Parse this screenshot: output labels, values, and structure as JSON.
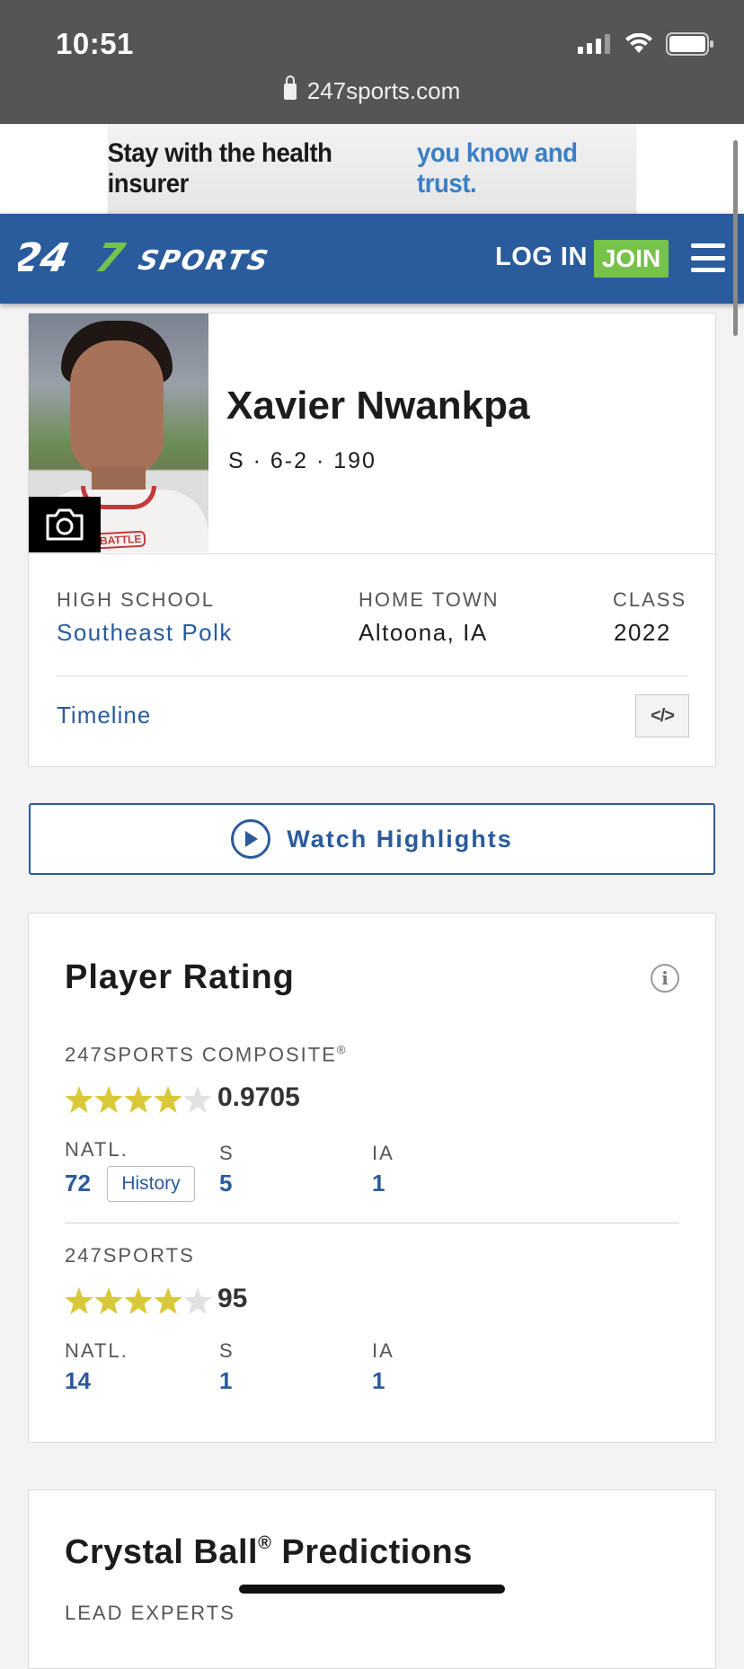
{
  "status_bar": {
    "time": "10:51",
    "url": "247sports.com"
  },
  "ad": {
    "text_dark": "Stay with the health insurer",
    "text_blue": "you know and trust."
  },
  "nav": {
    "logo": "247SPORTS",
    "login": "LOG IN",
    "join": "JOIN"
  },
  "player": {
    "name": "Xavier Nwankpa",
    "meta": "S · 6-2 · 190",
    "high_school_label": "HIGH SCHOOL",
    "high_school": "Southeast Polk",
    "home_town_label": "HOME TOWN",
    "home_town": "Altoona, IA",
    "class_label": "CLASS",
    "class": "2022",
    "timeline": "Timeline",
    "photo_text": "BATTLE",
    "embed_icon": "</>"
  },
  "highlights": {
    "label": "Watch Highlights"
  },
  "rating": {
    "title": "Player Rating",
    "composite": {
      "label": "247SPORTS COMPOSITE",
      "registered": "®",
      "stars": 4,
      "score": "0.9705",
      "natl_label": "NATL.",
      "natl": "72",
      "history": "History",
      "pos_label": "S",
      "pos": "5",
      "state_label": "IA",
      "state": "1"
    },
    "sports247": {
      "label": "247SPORTS",
      "stars": 4,
      "score": "95",
      "natl_label": "NATL.",
      "natl": "14",
      "pos_label": "S",
      "pos": "1",
      "state_label": "IA",
      "state": "1"
    }
  },
  "crystal_ball": {
    "title": "Crystal Ball",
    "registered": "®",
    "title_suffix": " Predictions",
    "lead": "LEAD EXPERTS"
  },
  "colors": {
    "brand_blue": "#2a5b9c",
    "join_green": "#77c24a",
    "star_gold": "#d9c93a"
  }
}
